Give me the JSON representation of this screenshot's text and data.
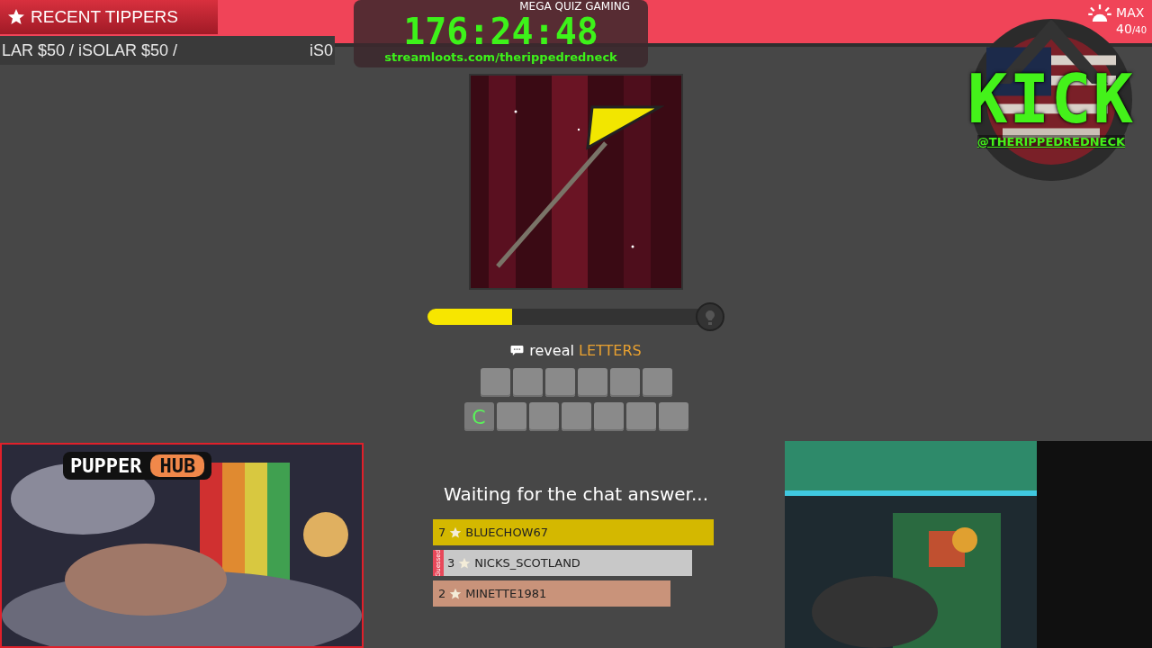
{
  "game_title": "MEGA QUIZ GAMING",
  "tippers": {
    "title": "RECENT TIPPERS",
    "ticker_left": "LAR $50 / iSOLAR $50 /",
    "ticker_right": "iS0"
  },
  "timer": {
    "time": "176:24:48",
    "url": "streamloots.com/therippedredneck"
  },
  "level": {
    "label": "MAX",
    "count": "40",
    "total": "/40"
  },
  "kick": {
    "logo": "KICK",
    "handle": "@THERIPPEDREDNECK"
  },
  "quiz": {
    "progress": {
      "level": 0.3
    },
    "hint_prefix": "reveal",
    "hint_word": "LETTERS",
    "rows": [
      {
        "tiles": [
          {
            "revealed": false
          },
          {
            "revealed": false
          },
          {
            "revealed": false
          },
          {
            "revealed": false
          },
          {
            "revealed": false
          },
          {
            "revealed": false
          }
        ]
      },
      {
        "tiles": [
          {
            "revealed": true,
            "letter": "C"
          },
          {
            "revealed": false
          },
          {
            "revealed": false
          },
          {
            "revealed": false
          },
          {
            "revealed": false
          },
          {
            "revealed": false
          },
          {
            "revealed": false
          }
        ]
      }
    ],
    "status": "Waiting for the chat answer...",
    "leaderboard": [
      {
        "score": "7",
        "name": "BLUECHOW67",
        "color": "#d4b800",
        "guessed": false
      },
      {
        "score": "3",
        "name": "NICKS_SCOTLAND",
        "color": "#c8c8c8",
        "guessed": true,
        "badge": "Guessed"
      },
      {
        "score": "2",
        "name": "MINETTE1981",
        "color": "#c9937a",
        "guessed": false
      }
    ]
  },
  "left_cam": {
    "brand_left": "PUPPER",
    "brand_right": "HUB"
  }
}
